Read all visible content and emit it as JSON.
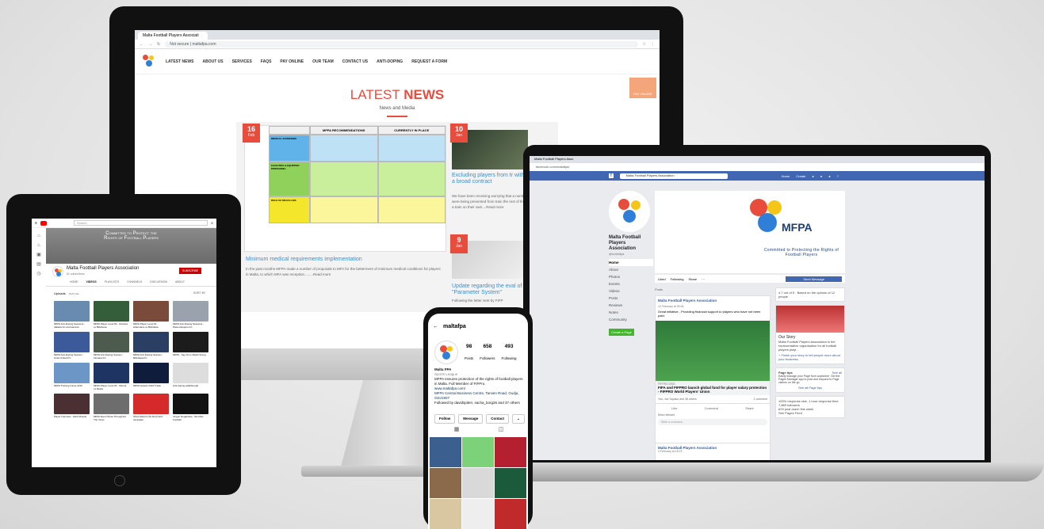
{
  "desktop": {
    "tab_title": "Malta Football Players Associati",
    "url_prefix": "Not secure",
    "url": "maltafpa.com",
    "logo_text": "MFPA",
    "nav": [
      "LATEST NEWS",
      "ABOUT US",
      "SERVICES",
      "FAQS",
      "PAY ONLINE",
      "OUR TEAM",
      "CONTACT US",
      "ANTI-DOPING",
      "REQUEST A FORM"
    ],
    "heading_light": "LATEST",
    "heading_bold": "NEWS",
    "subheading": "News and Media",
    "pay_badge": "PAY ONLINE",
    "post1": {
      "day": "16",
      "month": "Feb",
      "table_headers": [
        "MFPA RECOMMENDATIONS",
        "CURRENTLY IN PLACE"
      ],
      "table_rows": [
        "MEDICAL SCREENING",
        "FACILITIES & EQUIPPED PERSONNEL",
        "ROLE OF MFA/CLUBS"
      ],
      "title": "Minimum medical requirements implementation",
      "excerpt": "In the past months MFPA made a number of proposals to MFA for the betterment of minimum medical conditions for players in Malta, to which MFA was receptive.........Read more"
    },
    "post2": {
      "day": "10",
      "month": "Jan",
      "title": "Excluding players from tr with the team is a broad contract",
      "excerpt": "We have been receiving worrying that a number of professional were being prevented from train the rest of the team and instead a train on their own....Read more"
    },
    "post3": {
      "day": "9",
      "month": "Jan",
      "title": "Update regarding the eval of the \"Parameter System\"",
      "excerpt": "Following the letter sent by FIFP"
    }
  },
  "laptop": {
    "tab_title": "Malta Football Players Asso",
    "url": "facebook.com/maltafpa/",
    "search_value": "Malta Football Players Association",
    "top_links": [
      "Home",
      "Create"
    ],
    "page_name": "Malta Football Players Association",
    "handle": "@maltafpa",
    "menu": [
      "Home",
      "About",
      "Photos",
      "Events",
      "Videos",
      "Posts",
      "Reviews",
      "Notes",
      "Community"
    ],
    "create_page": "Create a Page",
    "cover_logo_text": "MFPA",
    "cover_tagline": "Committed to Protecting the Rights of Football Players",
    "actions": [
      "Liked",
      "Following",
      "Share"
    ],
    "send_message": "Send Message",
    "posts_label": "Posts",
    "post_author": "Malta Football Players Association",
    "post_date": "12 February at 09:04",
    "post_text": "Great initiative - Providing financial support to players who have not been paid.",
    "link_source": "FIFPRO.ORG",
    "link_title": "FIFA and FIFPRO launch global fund for player salary protection - FIFPRO World Players' Union",
    "reactions": "You, Joe Squaco and 38 others",
    "comments_count": "1 comment",
    "post_actions": [
      "Like",
      "Comment",
      "Share"
    ],
    "most_relevant": "Most relevant",
    "comment_placeholder": "Write a comment...",
    "post2_author": "Malta Football Players Association",
    "post2_date": "4 February at 18:22",
    "rating": "4.7 out of 5 · Based on the opinion of 12 people",
    "our_story_title": "Our Story",
    "our_story_text": "Malta Football Players Association is the representative organisation for all football players playi...",
    "story_link": "+ Finish your story to tell people more about your business.",
    "page_tips": "Page tips",
    "see_all": "See all",
    "tips_text": "Easily manage your Page from anywhere. Get the Pages Manager app to post and respond to Page visitors on the go.",
    "see_tips": "See all Page tips",
    "stats": [
      "100% response rate, 1 hour response time",
      "7,889 followers",
      "629 post reach this week",
      "See Pages Feed"
    ]
  },
  "tablet": {
    "search_placeholder": "Search",
    "banner_line1": "Committed to Protect the",
    "banner_line2": "Rights of Football Players",
    "channel_name": "Malta Football Players Association",
    "subscribers": "61 subscribers",
    "subscribe": "SUBSCRIBE",
    "tabs": [
      "HOME",
      "VIDEOS",
      "PLAYLISTS",
      "CHANNELS",
      "DISCUSSION",
      "ABOUT"
    ],
    "uploads": "Uploads",
    "play_all": "PLAY ALL",
    "sort": "SORT BY",
    "videos": [
      {
        "title": "MFPA Anti-Doping Sessions - Valletta FC and Hamrun",
        "color": "#6a8bb0"
      },
      {
        "title": "MFPA Player Level #3 - Floriana vs Birkirkara",
        "color": "#345e3a"
      },
      {
        "title": "MFPA Player Level #1 - Hibernians vs Birkirkara",
        "color": "#7a4a3a"
      },
      {
        "title": "MFPA Anti-Doping Sessions - Pieta Hotspurs FC",
        "color": "#9aa3ad"
      },
      {
        "title": "MFPA Anti-Doping Session - Gzira United FC",
        "color": "#3c5a9a"
      },
      {
        "title": "MFPA Anti-Doping Session - Floriana FC",
        "color": "#4d5a4e"
      },
      {
        "title": "MFPA Anti-Doping Session - Birkirkara FC",
        "color": "#2a3f63"
      },
      {
        "title": "MFPA - Say No to Match Fixing",
        "color": "#1c1c1c"
      },
      {
        "title": "MFPA Training Camp 2019",
        "color": "#6b96c6"
      },
      {
        "title": "MFPA Player Level #4 - Sliema vs Mosta",
        "color": "#1e3564"
      },
      {
        "title": "MFPA Awards 2019 Trailer",
        "color": "#101c3c"
      },
      {
        "title": "Anti-doping walkthrough",
        "color": "#dddddd"
      },
      {
        "title": "Player Interview - Zach Muscat",
        "color": "#4a2f33"
      },
      {
        "title": "MFPA Event Show Throughout The Years",
        "color": "#6d6d6d"
      },
      {
        "title": "Show Racism the Red Card campaign",
        "color": "#d52a2a"
      },
      {
        "title": "Jurgen Degabriele - We Miss Football",
        "color": "#121212"
      }
    ]
  },
  "phone": {
    "username": "maltafpa",
    "posts": "98",
    "posts_label": "Posts",
    "followers": "658",
    "followers_label": "Followers",
    "following": "493",
    "following_label": "Following",
    "bio_name": "Malta FPA",
    "bio_category": "Sports League",
    "bio_text": "MFPA ensures protection of the rights of football players in Malta. Full Member of FIFPro.",
    "bio_link": "www.maltafpa.com/",
    "bio_address": "MFPA Central Business Centre, Tarxien Road, Gudja, GDJ1907",
    "followed_by": "Followed by davidspiteri, sacha_borg26 and 37 others",
    "buttons": [
      "Follow",
      "Message",
      "Contact"
    ],
    "grid_colors": [
      "#3b5f8f",
      "#7bd279",
      "#b4202f",
      "#8a6a4a",
      "#d9d9d9",
      "#1b5a3a",
      "#d8c7a0",
      "#eeeeee",
      "#c02a2a"
    ]
  },
  "colors": {
    "mfpa_red": "#e84c3d",
    "mfpa_blue": "#2f7fd8",
    "mfpa_yellow": "#f5c518",
    "fb_blue": "#4267b2"
  }
}
